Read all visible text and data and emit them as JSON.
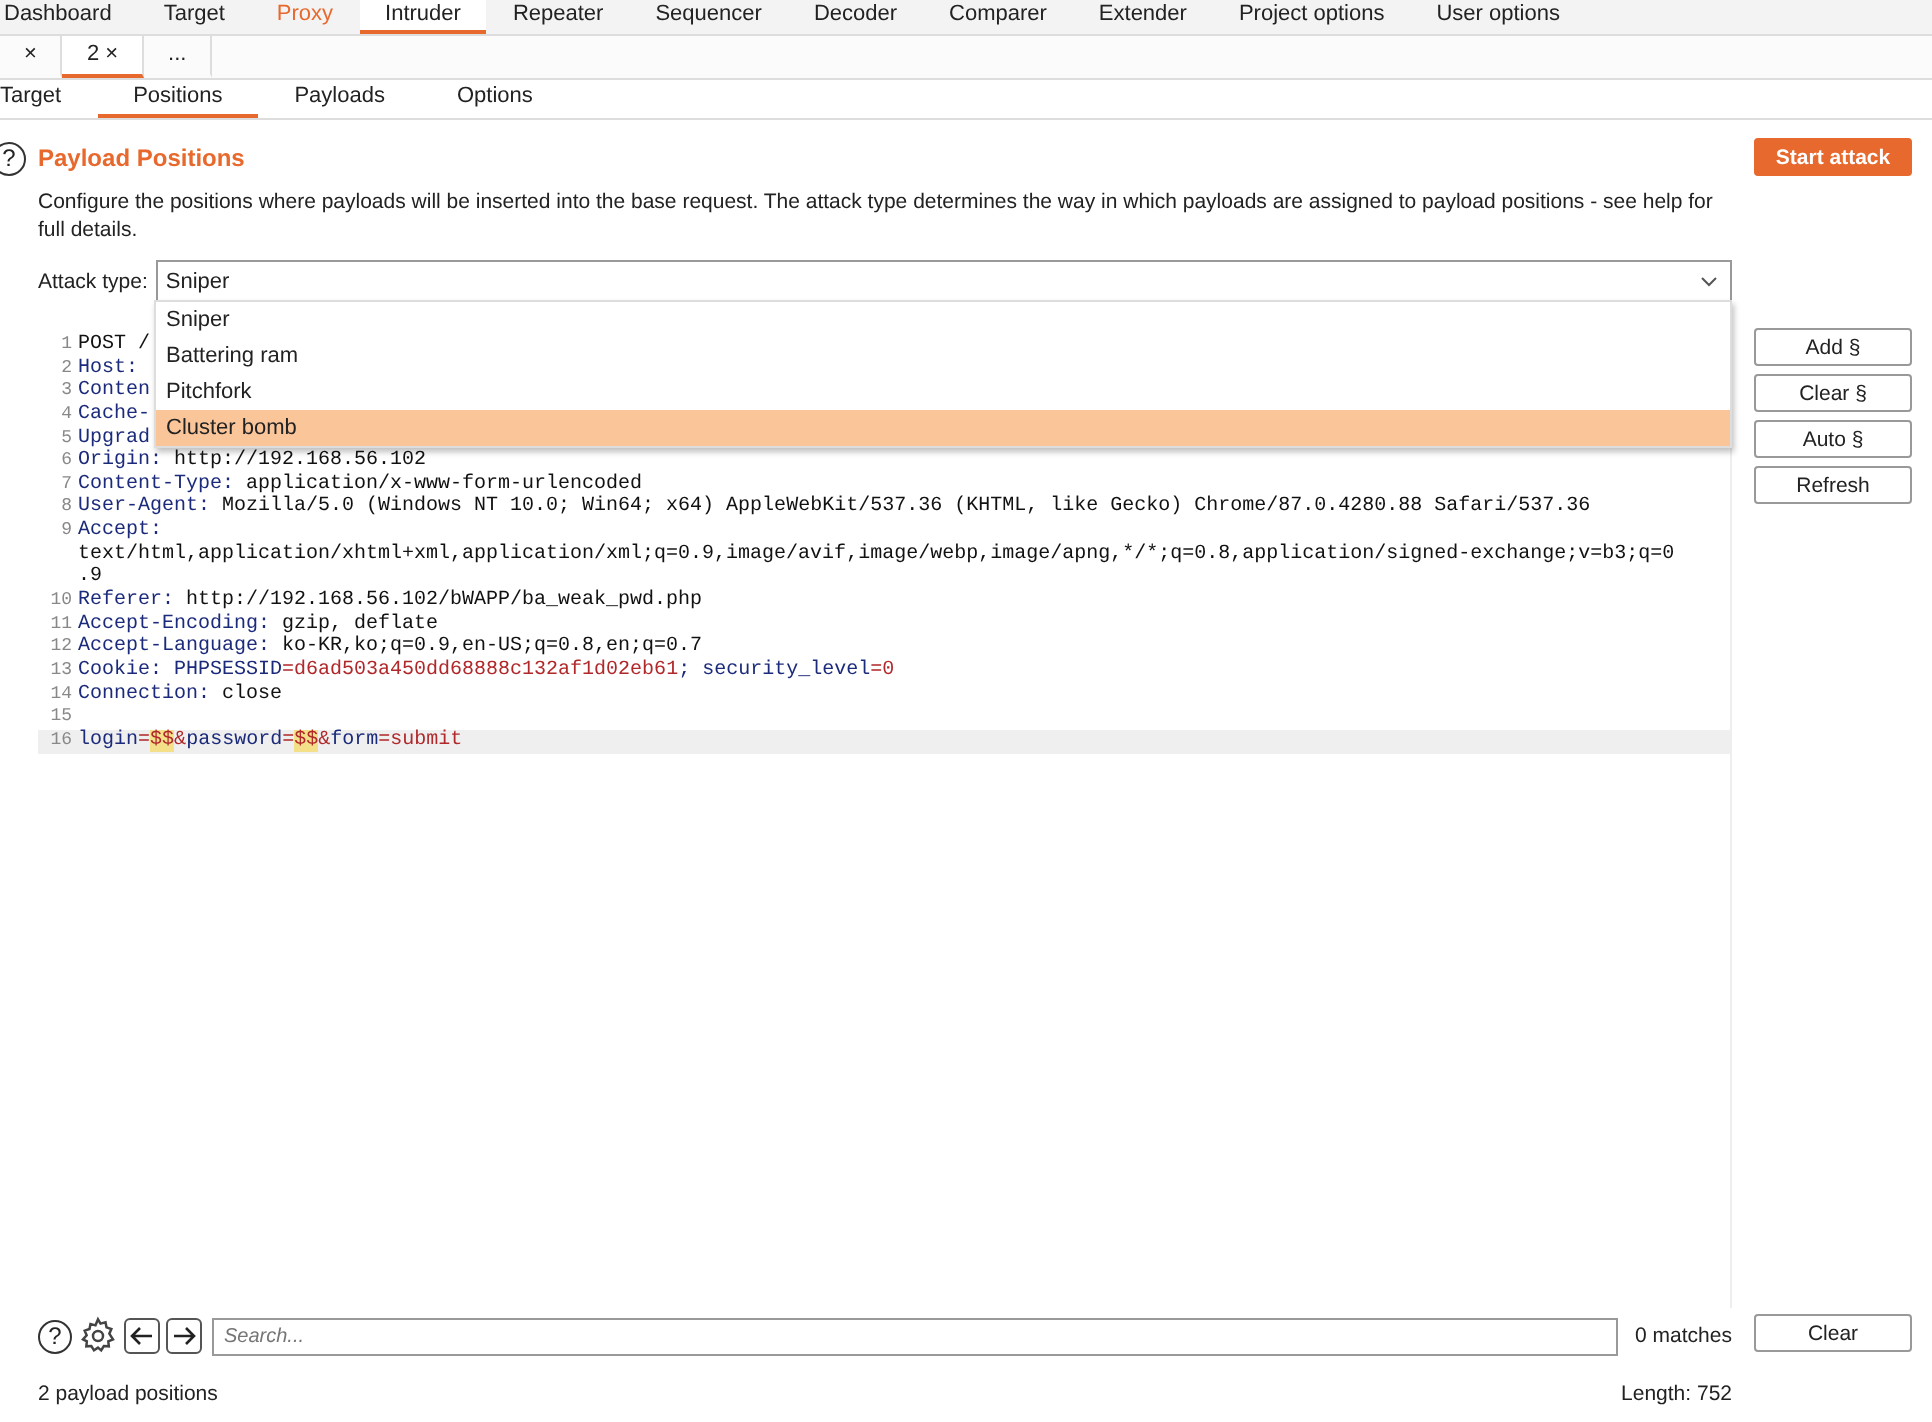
{
  "main_tabs": [
    {
      "label": "Dashboard",
      "selected": false,
      "highlighted": false
    },
    {
      "label": "Target",
      "selected": false,
      "highlighted": false
    },
    {
      "label": "Proxy",
      "selected": false,
      "highlighted": true
    },
    {
      "label": "Intruder",
      "selected": true,
      "highlighted": false
    },
    {
      "label": "Repeater",
      "selected": false,
      "highlighted": false
    },
    {
      "label": "Sequencer",
      "selected": false,
      "highlighted": false
    },
    {
      "label": "Decoder",
      "selected": false,
      "highlighted": false
    },
    {
      "label": "Comparer",
      "selected": false,
      "highlighted": false
    },
    {
      "label": "Extender",
      "selected": false,
      "highlighted": false
    },
    {
      "label": "Project options",
      "selected": false,
      "highlighted": false
    },
    {
      "label": "User options",
      "selected": false,
      "highlighted": false
    }
  ],
  "attack_tabs": [
    {
      "label": "×",
      "selected": false
    },
    {
      "label": "2 ×",
      "selected": true
    },
    {
      "label": "...",
      "selected": false
    }
  ],
  "sub_tabs": [
    {
      "label": "Target",
      "selected": false
    },
    {
      "label": "Positions",
      "selected": true
    },
    {
      "label": "Payloads",
      "selected": false
    },
    {
      "label": "Options",
      "selected": false
    }
  ],
  "help_icon": "?",
  "section_title": "Payload Positions",
  "description": "Configure the positions where payloads will be inserted into the base request. The attack type determines the way in which payloads are assigned to payload positions - see help for full details.",
  "start_button": "Start attack",
  "attack_type": {
    "label": "Attack type:",
    "value": "Sniper",
    "expanded": true,
    "options": [
      {
        "label": "Sniper",
        "highlighted": false
      },
      {
        "label": "Battering ram",
        "highlighted": false
      },
      {
        "label": "Pitchfork",
        "highlighted": false
      },
      {
        "label": "Cluster bomb",
        "highlighted": true
      }
    ]
  },
  "side_buttons": [
    "Add §",
    "Clear §",
    "Auto §",
    "Refresh"
  ],
  "editor_lines": [
    {
      "number": "1",
      "current": false,
      "segments": [
        {
          "kind": "plain",
          "text": "POST /"
        }
      ]
    },
    {
      "number": "2",
      "current": false,
      "segments": [
        {
          "kind": "name",
          "text": "Host:"
        }
      ]
    },
    {
      "number": "3",
      "current": false,
      "segments": [
        {
          "kind": "name",
          "text": "Conten"
        }
      ]
    },
    {
      "number": "4",
      "current": false,
      "segments": [
        {
          "kind": "name",
          "text": "Cache-"
        }
      ]
    },
    {
      "number": "5",
      "current": false,
      "segments": [
        {
          "kind": "name",
          "text": "Upgrad"
        }
      ]
    },
    {
      "number": "6",
      "current": false,
      "segments": [
        {
          "kind": "name",
          "text": "Origin:"
        },
        {
          "kind": "plain",
          "text": " http://192.168.56.102"
        }
      ]
    },
    {
      "number": "7",
      "current": false,
      "segments": [
        {
          "kind": "name",
          "text": "Content-Type:"
        },
        {
          "kind": "plain",
          "text": " application/x-www-form-urlencoded"
        }
      ]
    },
    {
      "number": "8",
      "current": false,
      "segments": [
        {
          "kind": "name",
          "text": "User-Agent:"
        },
        {
          "kind": "plain",
          "text": " Mozilla/5.0 (Windows NT 10.0; Win64; x64) AppleWebKit/537.36 (KHTML, like Gecko) Chrome/87.0.4280.88 Safari/537.36"
        }
      ]
    },
    {
      "number": "9",
      "current": false,
      "segments": [
        {
          "kind": "name",
          "text": "Accept:"
        }
      ]
    },
    {
      "current": false,
      "segments": [
        {
          "kind": "plain",
          "text": "text/html,application/xhtml+xml,application/xml;q=0.9,image/avif,image/webp,image/apng,*/*;q=0.8,application/signed-exchange;v=b3;q=0"
        }
      ]
    },
    {
      "current": false,
      "segments": [
        {
          "kind": "plain",
          "text": ".9"
        }
      ]
    },
    {
      "number": "10",
      "current": false,
      "segments": [
        {
          "kind": "name",
          "text": "Referer:"
        },
        {
          "kind": "plain",
          "text": " http://192.168.56.102/bWAPP/ba_weak_pwd.php"
        }
      ]
    },
    {
      "number": "11",
      "current": false,
      "segments": [
        {
          "kind": "name",
          "text": "Accept-Encoding:"
        },
        {
          "kind": "plain",
          "text": " gzip, deflate"
        }
      ]
    },
    {
      "number": "12",
      "current": false,
      "segments": [
        {
          "kind": "name",
          "text": "Accept-Language:"
        },
        {
          "kind": "plain",
          "text": " ko-KR,ko;q=0.9,en-US;q=0.8,en;q=0.7"
        }
      ]
    },
    {
      "number": "13",
      "current": false,
      "segments": [
        {
          "kind": "name",
          "text": "Cookie:"
        },
        {
          "kind": "name",
          "text": " PHPSESSID"
        },
        {
          "kind": "value",
          "text": "=d6ad503a450dd68888c132af1d02eb61"
        },
        {
          "kind": "name",
          "text": "; security_level"
        },
        {
          "kind": "value",
          "text": "=0"
        }
      ]
    },
    {
      "number": "14",
      "current": false,
      "segments": [
        {
          "kind": "name",
          "text": "Connection:"
        },
        {
          "kind": "plain",
          "text": " close"
        }
      ]
    },
    {
      "number": "15",
      "current": false
    },
    {
      "number": "16",
      "current": true,
      "segments": [
        {
          "kind": "name",
          "text": "login"
        },
        {
          "kind": "value",
          "text": "="
        },
        {
          "kind": "marker",
          "text": "$$"
        },
        {
          "kind": "value",
          "text": "&"
        },
        {
          "kind": "name",
          "text": "password"
        },
        {
          "kind": "value",
          "text": "="
        },
        {
          "kind": "marker",
          "text": "$$"
        },
        {
          "kind": "value",
          "text": "&"
        },
        {
          "kind": "name",
          "text": "form"
        },
        {
          "kind": "value",
          "text": "=submit"
        }
      ]
    }
  ],
  "search": {
    "help": "?",
    "placeholder": "Search...",
    "matches": "0 matches",
    "clear": "Clear"
  },
  "status": {
    "positions": "2 payload positions",
    "length": "Length: 752"
  }
}
